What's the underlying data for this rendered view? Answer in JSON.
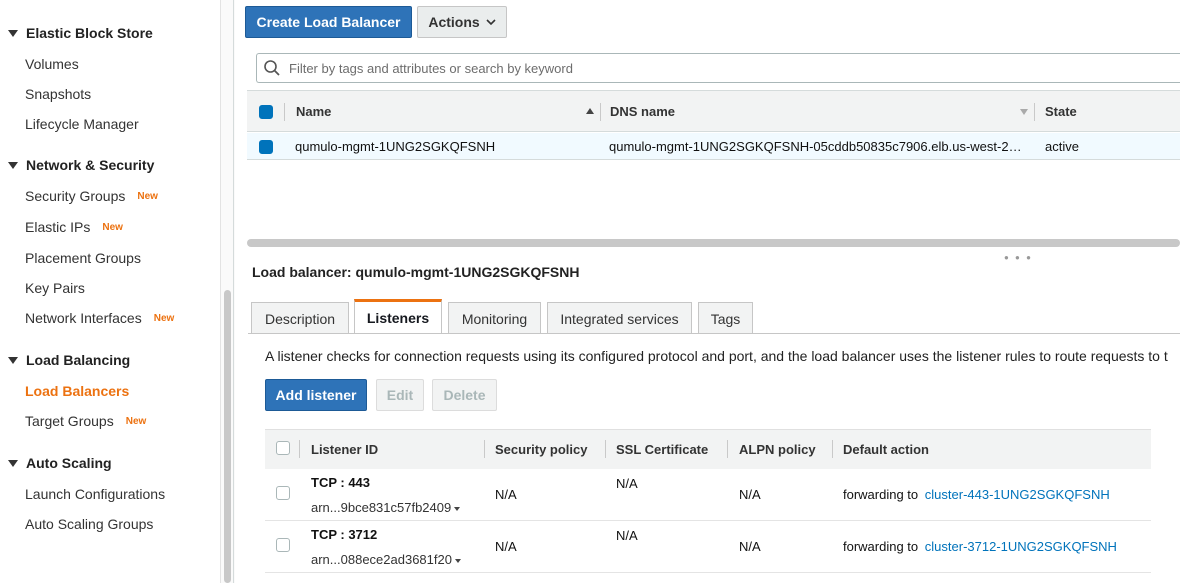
{
  "sidebar": {
    "sections": [
      {
        "title": "Elastic Block Store",
        "items": [
          {
            "label": "Volumes"
          },
          {
            "label": "Snapshots"
          },
          {
            "label": "Lifecycle Manager"
          }
        ]
      },
      {
        "title": "Network & Security",
        "items": [
          {
            "label": "Security Groups",
            "badge": "New"
          },
          {
            "label": "Elastic IPs",
            "badge": "New"
          },
          {
            "label": "Placement Groups"
          },
          {
            "label": "Key Pairs"
          },
          {
            "label": "Network Interfaces",
            "badge": "New"
          }
        ]
      },
      {
        "title": "Load Balancing",
        "items": [
          {
            "label": "Load Balancers",
            "active": true
          },
          {
            "label": "Target Groups",
            "badge": "New"
          }
        ]
      },
      {
        "title": "Auto Scaling",
        "items": [
          {
            "label": "Launch Configurations"
          },
          {
            "label": "Auto Scaling Groups"
          }
        ]
      }
    ]
  },
  "toolbar": {
    "create_label": "Create Load Balancer",
    "actions_label": "Actions"
  },
  "search": {
    "placeholder": "Filter by tags and attributes or search by keyword"
  },
  "lb_table": {
    "columns": {
      "name": "Name",
      "dns": "DNS name",
      "state": "State"
    },
    "rows": [
      {
        "name": "qumulo-mgmt-1UNG2SGKQFSNH",
        "dns": "qumulo-mgmt-1UNG2SGKQFSNH-05cddb50835c7906.elb.us-west-2…",
        "state": "active",
        "selected": true
      }
    ]
  },
  "detail": {
    "title": "Load balancer: qumulo-mgmt-1UNG2SGKQFSNH",
    "tabs": [
      "Description",
      "Listeners",
      "Monitoring",
      "Integrated services",
      "Tags"
    ],
    "active_tab": "Listeners"
  },
  "listeners": {
    "description": "A listener checks for connection requests using its configured protocol and port, and the load balancer uses the listener rules to route requests to t",
    "add_label": "Add listener",
    "edit_label": "Edit",
    "delete_label": "Delete",
    "columns": {
      "id": "Listener ID",
      "security_policy": "Security policy",
      "ssl_cert": "SSL Certificate",
      "alpn": "ALPN policy",
      "default_action": "Default action"
    },
    "rows": [
      {
        "protocol_port": "TCP : 443",
        "arn": "arn...9bce831c57fb2409",
        "security_policy": "N/A",
        "ssl_cert": "N/A",
        "alpn": "N/A",
        "action_prefix": "forwarding to",
        "action_target": "cluster-443-1UNG2SGKQFSNH"
      },
      {
        "protocol_port": "TCP : 3712",
        "arn": "arn...088ece2ad3681f20",
        "security_policy": "N/A",
        "ssl_cert": "N/A",
        "alpn": "N/A",
        "action_prefix": "forwarding to",
        "action_target": "cluster-3712-1UNG2SGKQFSNH"
      }
    ]
  },
  "colors": {
    "primary_button": "#2e73b8",
    "active_accent": "#ec7211",
    "link": "#0073bb"
  }
}
